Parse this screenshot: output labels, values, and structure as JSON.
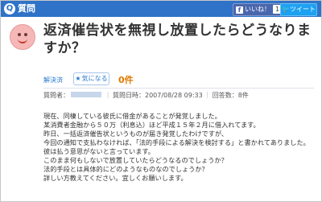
{
  "topbar": {
    "icon_glyph": "Q",
    "section_label": "質問",
    "like_label": "いいね！",
    "like_count": "1",
    "tweet_label": "ツイート"
  },
  "question": {
    "title": "返済催告状を無視し放置したらどうなりますか？",
    "status": "解決済",
    "watch_label": "気になる",
    "watch_count": "0件",
    "asker_label": "質問者：",
    "date_label": "質問日時：",
    "date": "2007/08/28 09:33",
    "answers": "回答数：8件",
    "body_lines": [
      "現在、同棲している彼氏に借金があることが発覚しました。",
      "某消費者金融から５０万（利息込）ほど平成１５年２月に借入れてます。",
      "昨日、一括返済催告状というものが届き発覚したわけですが、",
      "今回の通知で支払わなければ、「法的手段による解決を検討する」と書かれてありました。",
      "彼は払う意思がないと言っています。",
      "このまま何もしないで放置していたらどうなるのでしょうか？",
      "法的手段とは具体的にどのようなものなのでしょうか？",
      "詳しい方教えてください。宜しくお願いします。"
    ]
  },
  "colors": {
    "topbar": "#2f73c8",
    "facebook": "#4a66ad",
    "twitter": "#1da1f2",
    "link": "#2a7bd0",
    "count": "#e07a00"
  }
}
